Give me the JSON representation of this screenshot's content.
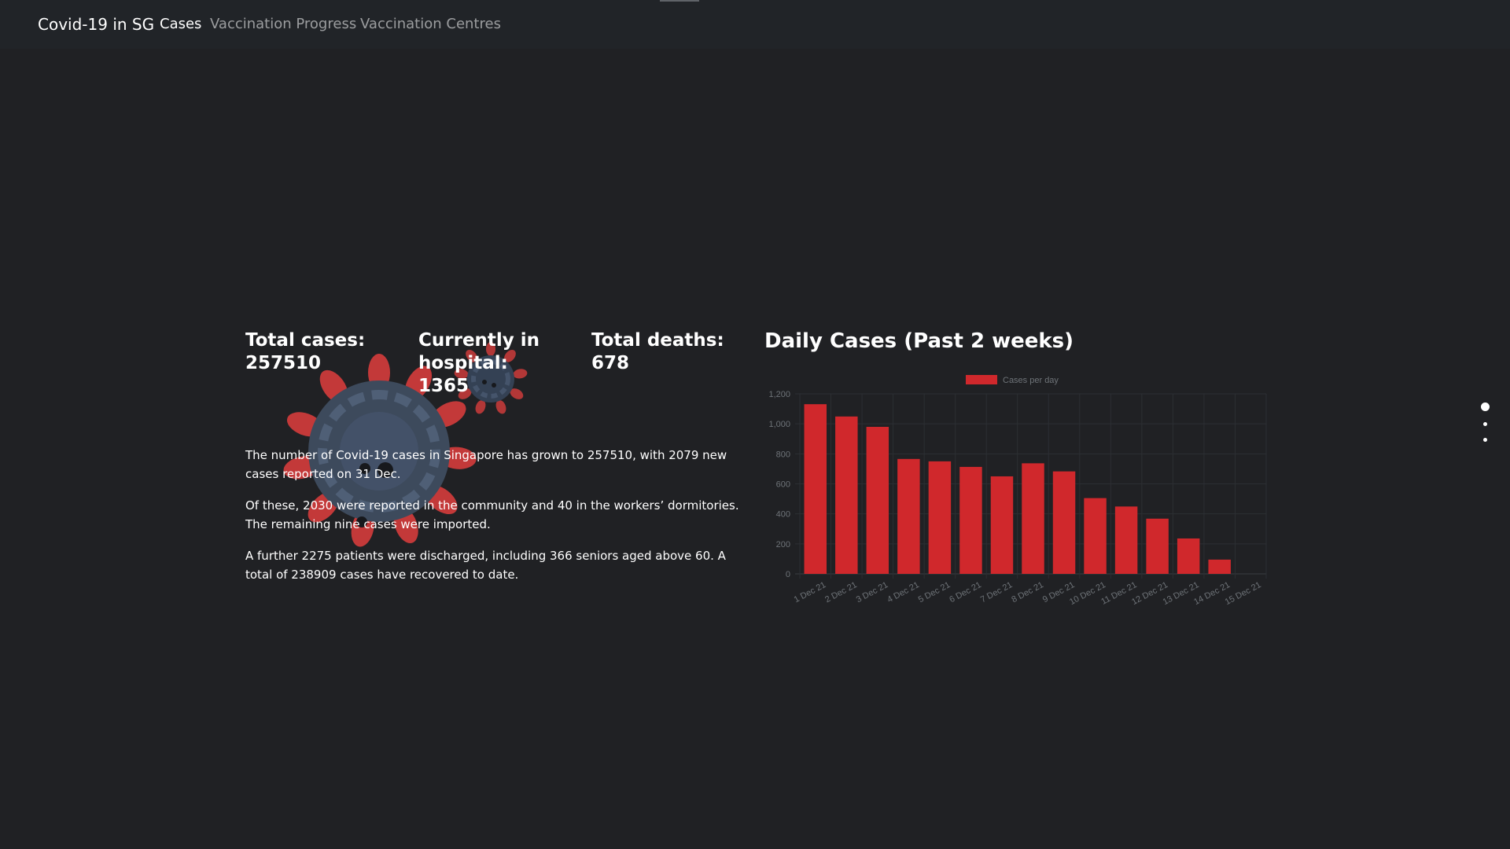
{
  "nav": {
    "brand": "Covid-19 in SG",
    "links": [
      {
        "label": "Cases",
        "active": true
      },
      {
        "label": "Vaccination Progress",
        "active": false
      },
      {
        "label": "Vaccination Centres",
        "active": false
      }
    ]
  },
  "stats": {
    "total_cases": {
      "label": "Total cases:",
      "value": "257510"
    },
    "hospital": {
      "label_line1": "Currently in",
      "label_line2": "hospital:",
      "value": "1365"
    },
    "deaths": {
      "label": "Total deaths:",
      "value": "678"
    }
  },
  "paragraphs": [
    "The number of Covid-19 cases in Singapore has grown to 257510, with 2079 new cases reported on 31 Dec.",
    "Of these, 2030 were reported in the community and 40 in the workers’ dormitories. The remaining nine cases were imported.",
    "A further 2275 patients were discharged, including 366 seniors aged above 60. A total of 238909 cases have recovered to date."
  ],
  "chart_title": "Daily Cases (Past 2 weeks)",
  "colors": {
    "background": "#202124",
    "navbar": "#212428",
    "bar": "#d0282c",
    "virus_body": "#3d4a5c",
    "virus_spike": "#cc3b3b"
  },
  "page_dots": [
    true,
    false,
    false
  ],
  "chart_data": {
    "type": "bar",
    "categories": [
      "1 Dec 21",
      "2 Dec 21",
      "3 Dec 21",
      "4 Dec 21",
      "5 Dec 21",
      "6 Dec 21",
      "7 Dec 21",
      "8 Dec 21",
      "9 Dec 21",
      "10 Dec 21",
      "11 Dec 21",
      "12 Dec 21",
      "13 Dec 21",
      "14 Dec 21",
      "15 Dec 21"
    ],
    "series": [
      {
        "name": "Cases per day",
        "values": [
          1131,
          1049,
          980,
          766,
          750,
          713,
          650,
          737,
          683,
          505,
          449,
          368,
          236,
          95,
          0
        ]
      }
    ],
    "ylim": [
      0,
      1200
    ],
    "yticks": [
      0,
      200,
      400,
      600,
      800,
      1000,
      1200
    ],
    "ytick_labels": [
      "0",
      "200",
      "400",
      "600",
      "800",
      "1,000",
      "1,200"
    ],
    "legend": "top-center",
    "grid": true
  }
}
